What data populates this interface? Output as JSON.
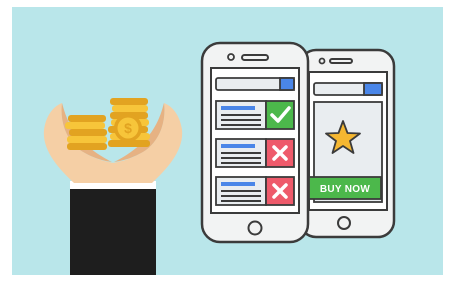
{
  "illustration": {
    "buy_button_label": "BUY NOW",
    "icons": {
      "coins": "gold-coin-stacks",
      "dollar_coin": "dollar-coin",
      "check": "check-mark",
      "cross": "x-mark",
      "star": "star"
    },
    "colors": {
      "background_panel": "#b9e6ea",
      "phone_frame": "#f2f3f3",
      "phone_outline": "#3b3b3b",
      "screen_fill": "#ffffff",
      "address_bar": "#e9edf0",
      "accent_blue": "#4a86e8",
      "check_green": "#4cb84b",
      "cross_red": "#ee5a6b",
      "buy_green": "#4cb84b",
      "star_gold": "#f5b731",
      "coin_gold": "#f7c53a",
      "coin_dark": "#e2a321",
      "skin": "#f5cfa5",
      "skin_shade": "#e6b283",
      "sleeve": "#1e1e1e",
      "cuff": "#ffffff"
    }
  }
}
